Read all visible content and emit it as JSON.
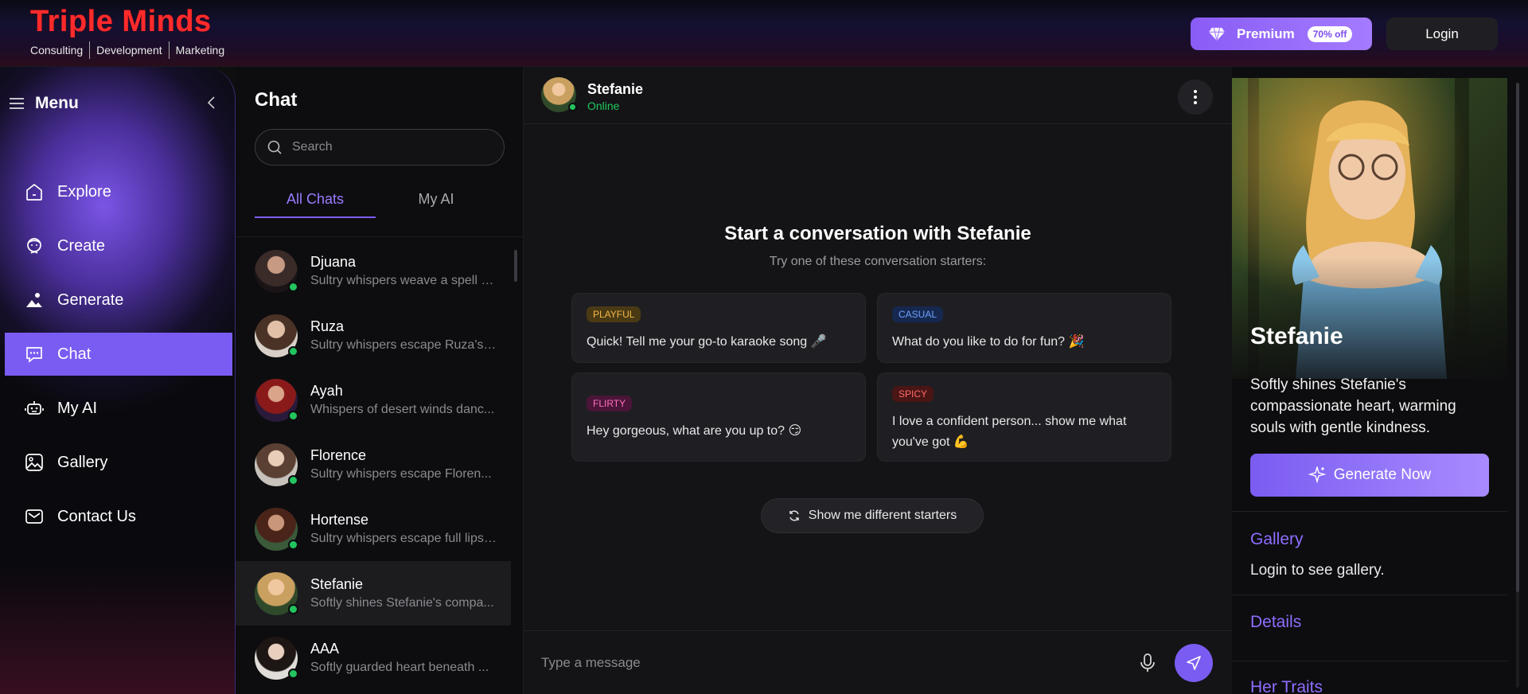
{
  "brand": {
    "name": "Triple Minds",
    "tags": [
      "Consulting",
      "Development",
      "Marketing"
    ]
  },
  "topbar": {
    "premium_label": "Premium",
    "premium_badge": "70% off",
    "login_label": "Login"
  },
  "menu": {
    "title": "Menu",
    "items": [
      {
        "label": "Explore",
        "icon": "home-icon"
      },
      {
        "label": "Create",
        "icon": "avatar-face-icon"
      },
      {
        "label": "Generate",
        "icon": "image-icon"
      },
      {
        "label": "Chat",
        "icon": "chat-icon",
        "active": true
      },
      {
        "label": "My AI",
        "icon": "robot-icon"
      },
      {
        "label": "Gallery",
        "icon": "gallery-icon"
      },
      {
        "label": "Contact Us",
        "icon": "mail-icon"
      }
    ]
  },
  "chatlist": {
    "title": "Chat",
    "search_placeholder": "Search",
    "tabs": [
      "All Chats",
      "My AI"
    ],
    "conversations": [
      {
        "name": "Djuana",
        "preview": "Sultry whispers weave a spell o..."
      },
      {
        "name": "Ruza",
        "preview": "Sultry whispers escape Ruza's li..."
      },
      {
        "name": "Ayah",
        "preview": "Whispers of desert winds danc..."
      },
      {
        "name": "Florence",
        "preview": "Sultry whispers escape Floren..."
      },
      {
        "name": "Hortense",
        "preview": "Sultry whispers escape full lips, ..."
      },
      {
        "name": "Stefanie",
        "preview": "Softly shines Stefanie's compa..."
      },
      {
        "name": "AAA",
        "preview": "Softly guarded heart beneath ..."
      }
    ]
  },
  "chat": {
    "name": "Stefanie",
    "status": "Online",
    "start_title": "Start a conversation with Stefanie",
    "start_sub": "Try one of these conversation starters:",
    "starters": [
      {
        "tag": "PLAYFUL",
        "text": "Quick! Tell me your go-to karaoke song 🎤"
      },
      {
        "tag": "CASUAL",
        "text": "What do you like to do for fun? 🎉"
      },
      {
        "tag": "FLIRTY",
        "text": "Hey gorgeous, what are you up to? 😏"
      },
      {
        "tag": "SPICY",
        "text": "I love a confident person... show me what you've got 💪"
      }
    ],
    "different_label": "Show me different starters",
    "message_placeholder": "Type a message"
  },
  "profile": {
    "name": "Stefanie",
    "description": "Softly shines Stefanie's compassionate heart, warming souls with gentle kindness.",
    "generate_label": "Generate Now",
    "gallery_title": "Gallery",
    "gallery_text": "Login to see gallery.",
    "details_title": "Details",
    "traits_title": "Her Traits"
  },
  "colors": {
    "accent": "#7b5cf2",
    "online": "#22c55e",
    "brand_red": "#ff2b2b"
  }
}
